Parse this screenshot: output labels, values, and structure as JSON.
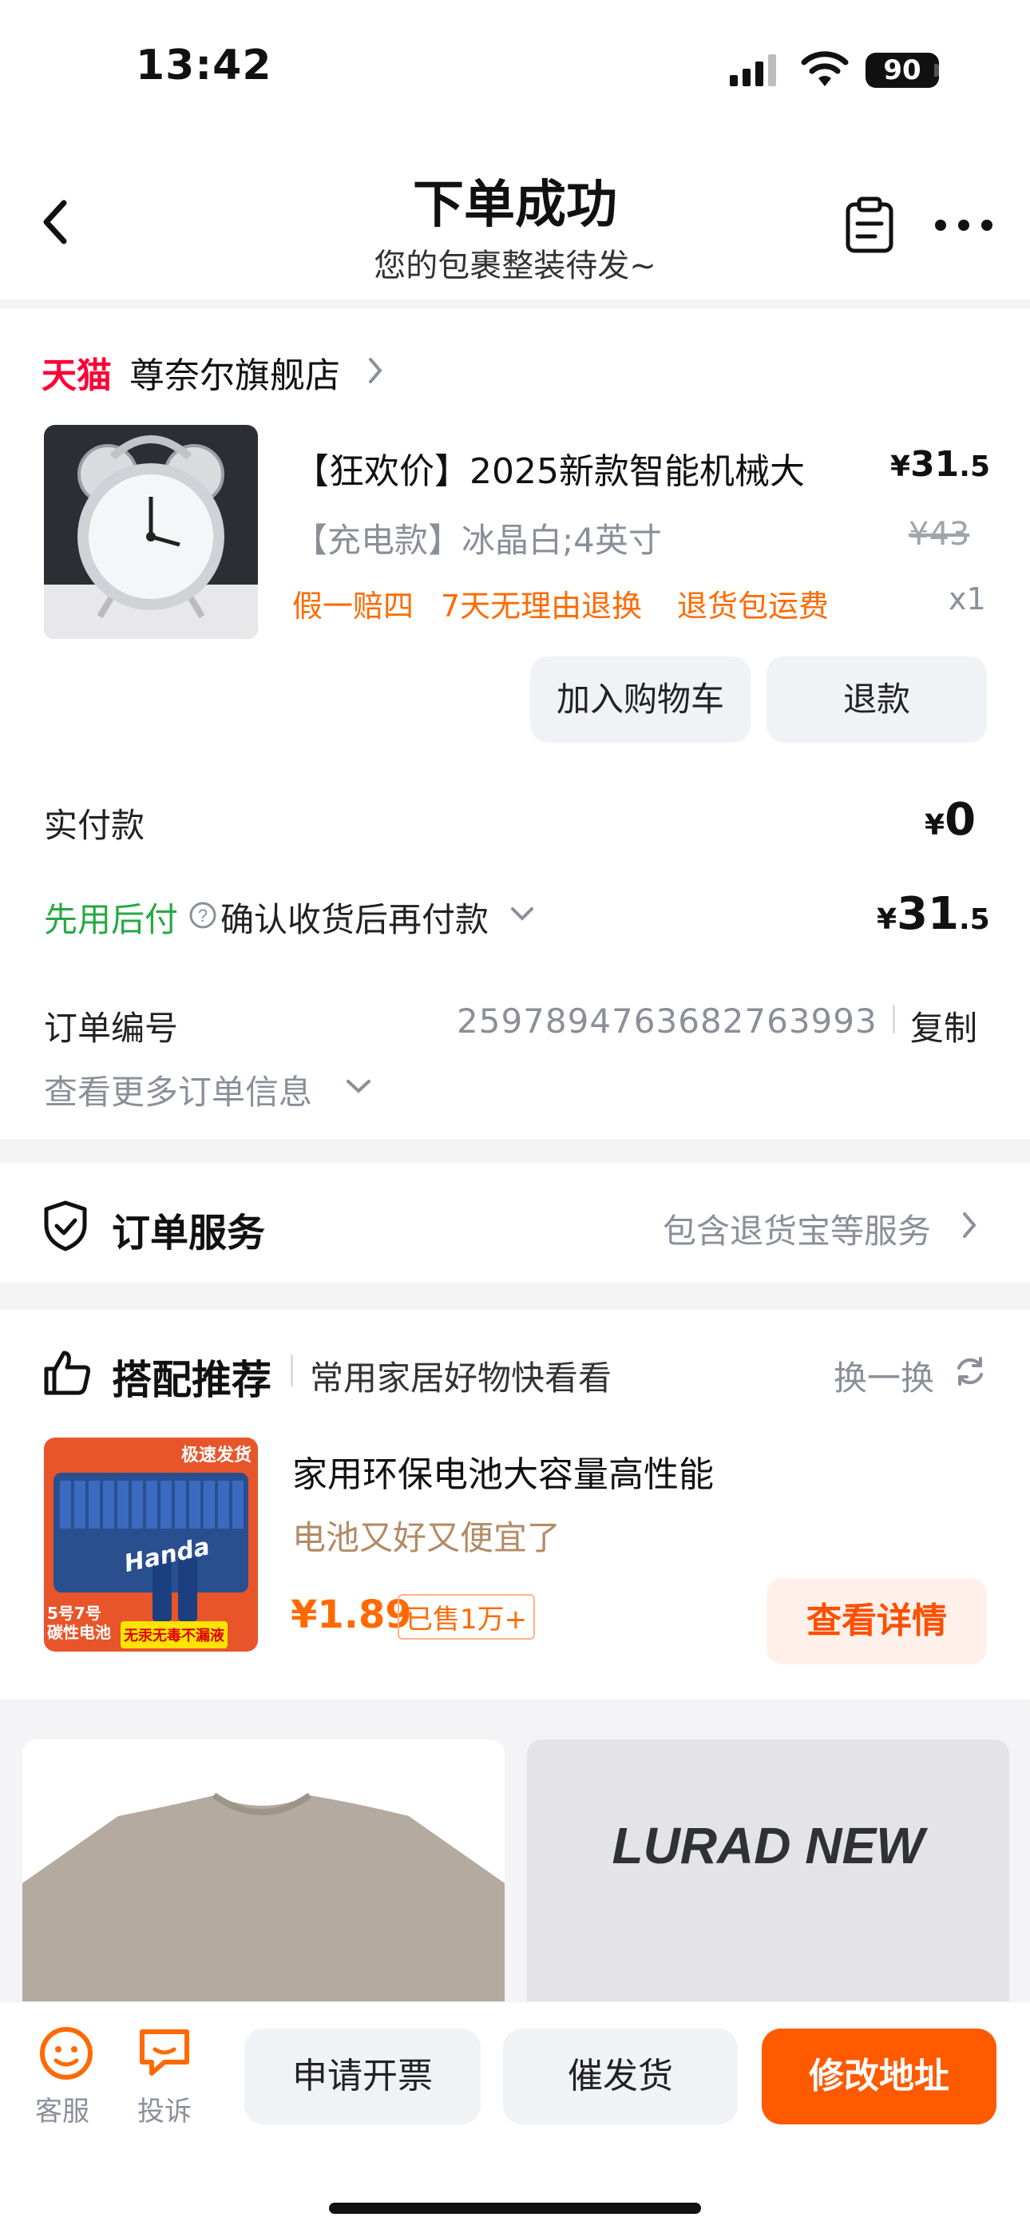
{
  "status": {
    "time": "13:42",
    "battery": "90"
  },
  "header": {
    "title": "下单成功",
    "subtitle": "您的包裹整装待发~"
  },
  "store": {
    "platform": "天猫",
    "name": "尊奈尔旗舰店"
  },
  "product": {
    "title": "【狂欢价】2025新款智能机械大",
    "price_symbol": "¥",
    "price_int": "31",
    "price_dec": ".5",
    "sku": "【充电款】冰晶白;4英寸",
    "original_price": "¥43",
    "promos": [
      "假一赔四",
      "7天无理由退换",
      "退货包运费"
    ],
    "quantity": "x1",
    "buttons": {
      "add_cart": "加入购物车",
      "refund": "退款"
    }
  },
  "payment": {
    "paid_label": "实付款",
    "paid_symbol": "¥",
    "paid_value": "0",
    "later_label": "先用后付",
    "later_desc": "确认收货后再付款",
    "later_symbol": "¥",
    "later_int": "31",
    "later_dec": ".5"
  },
  "order": {
    "number_label": "订单编号",
    "number": "2597894763682763993",
    "copy": "复制",
    "more": "查看更多订单信息"
  },
  "service": {
    "label": "订单服务",
    "desc": "包含退货宝等服务"
  },
  "recommend": {
    "title": "搭配推荐",
    "subtitle": "常用家居好物快看看",
    "refresh": "换一换",
    "item": {
      "name": "家用环保电池大容量高性能",
      "tagline": "电池又好又便宜了",
      "price": "¥1.89",
      "sold": "已售1万+",
      "detail_button": "查看详情",
      "img_badge": "极速发货",
      "img_brand": "Handa",
      "img_label1": "5号7号",
      "img_label2": "碳性电池",
      "img_label3": "无汞无毒不漏液"
    }
  },
  "feed": {
    "card2_text": "LURAD NEW"
  },
  "bottom": {
    "service": "客服",
    "complaint": "投诉",
    "invoice": "申请开票",
    "urge": "催发货",
    "modify": "修改地址"
  },
  "colors": {
    "accent": "#ff6a00",
    "brand_red": "#ff0036",
    "green": "#27a845"
  }
}
